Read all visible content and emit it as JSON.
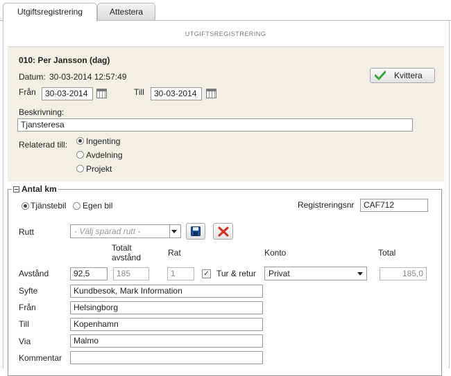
{
  "tabs": [
    {
      "label": "Utgiftsregistrering",
      "active": true
    },
    {
      "label": "Attestera",
      "active": false
    }
  ],
  "section_title": "UTGIFTSREGISTRERING",
  "header": {
    "employee": "010: Per Jansson (dag)",
    "datum_label": "Datum:",
    "datum_value": "30-03-2014 12:57:49",
    "kvittera_label": "Kvittera",
    "fran_label": "Från",
    "fran_value": "30-03-2014",
    "till_label": "Till",
    "till_value": "30-03-2014",
    "beskrivning_label": "Beskrivning:",
    "beskrivning_value": "Tjansteresa",
    "relaterad_label": "Relaterad till:",
    "relaterad_options": [
      "Ingenting",
      "Avdelning",
      "Projekt"
    ],
    "relaterad_selected": "Ingenting"
  },
  "km": {
    "legend": "Antal km",
    "vehicle_options": [
      "Tjänstebil",
      "Egen bil"
    ],
    "vehicle_selected": "Tjänstebil",
    "regnr_label": "Registreringsnr",
    "regnr_value": "CAF712",
    "rutt_label": "Rutt",
    "rutt_placeholder": "- Välj sparad rutt -",
    "col_totalt": "Totalt avstånd",
    "col_rat": "Rat",
    "col_konto": "Konto",
    "col_total": "Total",
    "avstand_label": "Avstånd",
    "avstand_value": "92,5",
    "totalt_value": "185",
    "rat_value": "1",
    "tur_retur_label": "Tur & retur",
    "tur_retur_checked": true,
    "konto_value": "Privat",
    "total_value": "185,0",
    "syfte_label": "Syfte",
    "syfte_value": "Kundbesok, Mark Information",
    "fran_label": "Från",
    "fran_value": "Helsingborg",
    "till_label": "Till",
    "till_value": "Kopenhamn",
    "via_label": "Via",
    "via_value": "Malmo",
    "kommentar_label": "Kommentar",
    "kommentar_value": ""
  },
  "colors": {
    "accent_check": "#3aa53a",
    "delete_red": "#d03020",
    "save_blue": "#1f4f9a"
  }
}
